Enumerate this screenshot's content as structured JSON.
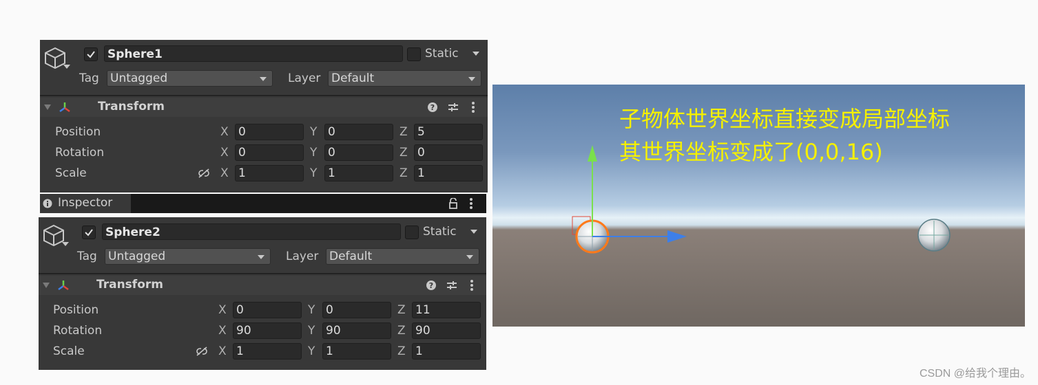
{
  "inspector_tab": {
    "label": "Inspector"
  },
  "panels": [
    {
      "object_name": "Sphere1",
      "static_label": "Static",
      "tag_label": "Tag",
      "tag_value": "Untagged",
      "layer_label": "Layer",
      "layer_value": "Default",
      "component_title": "Transform",
      "position": {
        "label": "Position",
        "x": "0",
        "y": "0",
        "z": "5"
      },
      "rotation": {
        "label": "Rotation",
        "x": "0",
        "y": "0",
        "z": "0"
      },
      "scale": {
        "label": "Scale",
        "x": "1",
        "y": "1",
        "z": "1"
      }
    },
    {
      "object_name": "Sphere2",
      "static_label": "Static",
      "tag_label": "Tag",
      "tag_value": "Untagged",
      "layer_label": "Layer",
      "layer_value": "Default",
      "component_title": "Transform",
      "position": {
        "label": "Position",
        "x": "0",
        "y": "0",
        "z": "11"
      },
      "rotation": {
        "label": "Rotation",
        "x": "90",
        "y": "90",
        "z": "90"
      },
      "scale": {
        "label": "Scale",
        "x": "1",
        "y": "1",
        "z": "1"
      }
    }
  ],
  "axis_labels": {
    "x": "X",
    "y": "Y",
    "z": "Z"
  },
  "scene": {
    "caption_line1": "子物体世界坐标直接变成局部坐标",
    "caption_line2": "其世界坐标变成了(0,0,16)"
  },
  "watermark": "CSDN @给我个理由。",
  "colors": {
    "panel_bg": "#383838",
    "caption": "#f5f000",
    "gizmo_x": "#3d7fe8",
    "gizmo_y": "#7ae04c"
  }
}
